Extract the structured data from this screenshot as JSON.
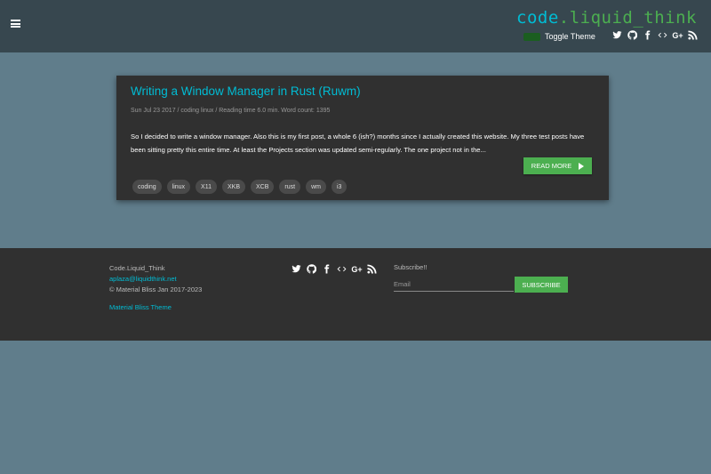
{
  "header": {
    "logo_part1": "code",
    "logo_part2": ".liquid_think",
    "toggle_label": "Toggle Theme",
    "social_icons": [
      "twitter-icon",
      "github-icon",
      "facebook-icon",
      "code-icon",
      "google-plus-icon",
      "rss-icon"
    ],
    "google_plus_text": "G+"
  },
  "post": {
    "title": "Writing a Window Manager in Rust (Ruwm)",
    "meta": "Sun Jul 23 2017 / coding linux / Reading time 6.0 min. Word count: 1395",
    "excerpt": "So I decided to write a window manager. Also this is my first post, a whole 6 (ish?) months since I actually created this website. My three test posts have been sitting pretty this entire time. At least the Projects section was updated semi-regularly. The one project not in the...",
    "read_more": "READ MORE",
    "tags": [
      "coding",
      "linux",
      "X11",
      "XKB",
      "XCB",
      "rust",
      "wm",
      "i3"
    ]
  },
  "footer": {
    "site_name": "Code.Liquid_Think",
    "email": "aplaza@liquidthink.net",
    "copyright": "© Material Bliss Jan 2017-2023",
    "theme_link": "Material Bliss Theme",
    "subscribe_label": "Subscribe!!",
    "email_placeholder": "Email",
    "subscribe_button": "SUBSCRIBE",
    "google_plus_text": "G+"
  },
  "colors": {
    "background": "#607d8b",
    "header": "#37474f",
    "card": "#303030",
    "accent_cyan": "#00bcd4",
    "accent_green": "#4caf50"
  }
}
